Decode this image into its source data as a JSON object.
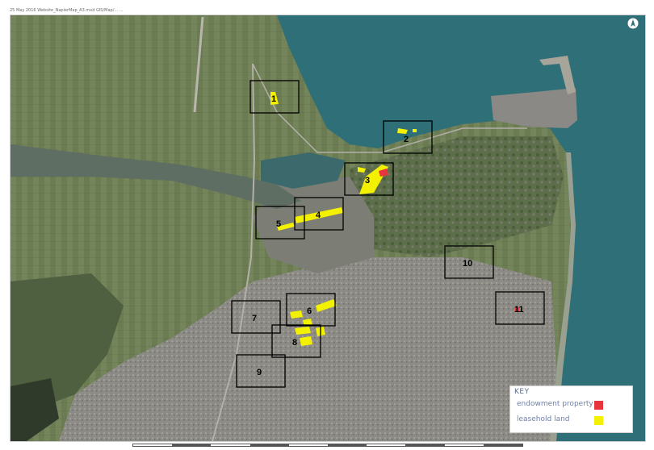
{
  "header": {
    "text": "25 May 2016   Website_NapierMap_A3.mxd   GIS/Map/...   ..."
  },
  "map": {
    "areas": [
      {
        "number": "1"
      },
      {
        "number": "2"
      },
      {
        "number": "3"
      },
      {
        "number": "4"
      },
      {
        "number": "5"
      },
      {
        "number": "6"
      },
      {
        "number": "7"
      },
      {
        "number": "8"
      },
      {
        "number": "9"
      },
      {
        "number": "10"
      },
      {
        "number": "11"
      }
    ]
  },
  "key": {
    "title": "KEY",
    "items": [
      {
        "label": "endowment property",
        "color": "#e8343c"
      },
      {
        "label": "leasehold land",
        "color": "#f3f000"
      }
    ]
  },
  "colors": {
    "sea": "#2f6f78",
    "urban": "#8e8e8a",
    "farmland": "#6f7f55",
    "box_stroke": "#000000"
  },
  "north_arrow": "north-arrow-icon"
}
